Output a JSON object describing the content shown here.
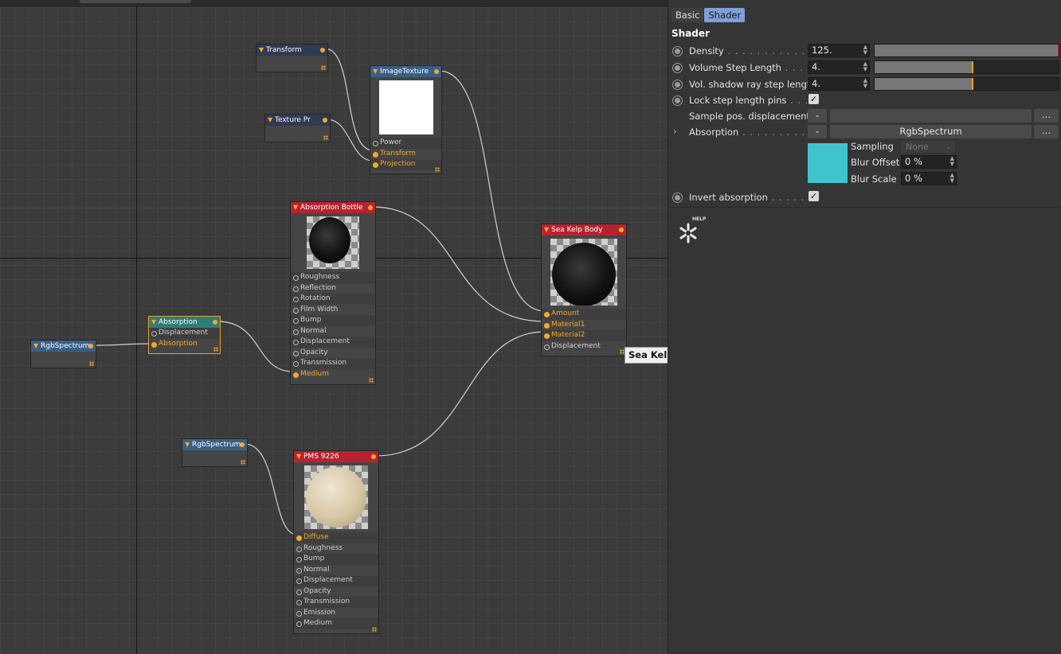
{
  "nodes": {
    "transform": {
      "title": "Transform"
    },
    "texture_projection": {
      "title": "Texture Pr"
    },
    "image_texture": {
      "title": "ImageTexture",
      "pins": [
        "Power",
        "Transform",
        "Projection"
      ]
    },
    "absorption_bottle": {
      "title": "Absorption Bottle",
      "pins": [
        "Roughness",
        "Reflection",
        "Rotation",
        "Film Width",
        "Bump",
        "Normal",
        "Displacement",
        "Opacity",
        "Transmission",
        "Medium"
      ]
    },
    "absorption": {
      "title": "Absorption",
      "pins": [
        "Displacement",
        "Absorption"
      ]
    },
    "rgb_spectrum_1": {
      "title": "RgbSpectrum"
    },
    "rgb_spectrum_2": {
      "title": "RgbSpectrum"
    },
    "sea_kelp_body": {
      "title": "Sea Kelp Body",
      "pins": [
        "Amount",
        "Material1",
        "Material2",
        "Displacement"
      ]
    },
    "pms_9226": {
      "title": "PMS 9226",
      "pins": [
        "Diffuse",
        "Roughness",
        "Bump",
        "Normal",
        "Displacement",
        "Opacity",
        "Transmission",
        "Emission",
        "Medium"
      ]
    }
  },
  "tooltip": "Sea Kelp Body Wash Bottle Mix [Octane Mix Material]",
  "panel": {
    "tabs": [
      "Basic",
      "Shader"
    ],
    "active_tab": "Shader",
    "section_title": "Shader",
    "density": {
      "label": "Density",
      "dots": " . . . . . . . . . . . . . .",
      "value": "125."
    },
    "volume_step": {
      "label": "Volume Step Length",
      "dots": " . . . . .",
      "value": "4."
    },
    "vol_shadow": {
      "label": "Vol. shadow ray step length",
      "value": "4."
    },
    "lock_step": {
      "label": "Lock step length pins",
      "dots": " . . . .",
      "checked": true
    },
    "sample_pos": {
      "label": "Sample pos. displacement"
    },
    "absorption": {
      "label": "Absorption",
      "dots": " . . . . . . . . . . . .",
      "link": "RgbSpectrum",
      "swatch_color": "#3fc4cf"
    },
    "sampling": {
      "label": "Sampling",
      "value": "None"
    },
    "blur_offset": {
      "label": "Blur Offset",
      "value": "0 %"
    },
    "blur_scale": {
      "label": "Blur Scale",
      "value": "0 %"
    },
    "invert_absorption": {
      "label": "Invert absorption",
      "dots": " . . . . . . .",
      "checked": true
    },
    "help_label": "HELP",
    "ellipsis": "...",
    "check_mark": "✓"
  },
  "colors": {
    "accent_orange": "#f3a92b",
    "material_red": "#b8222f",
    "texture_blue": "#3a5f86",
    "medium_teal": "#2f7d78",
    "tab_active": "#7f9fd8"
  }
}
